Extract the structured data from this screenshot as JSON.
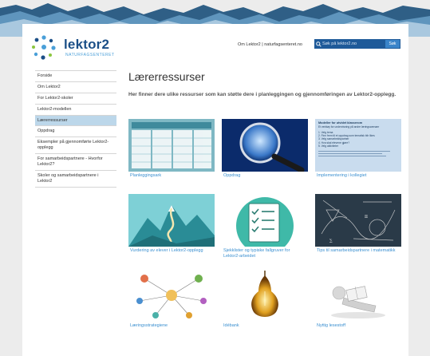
{
  "header": {
    "logo_name": "lektor2",
    "logo_subtitle": "NATURFAGSENTERET",
    "links": [
      "Om Lektor2",
      "|",
      "naturfagsenteret.no"
    ],
    "search_placeholder": "Søk på lektor2.no",
    "search_button": "Søk"
  },
  "sidebar": {
    "items": [
      {
        "label": "Forside"
      },
      {
        "label": "Om Lektor2"
      },
      {
        "label": "For Lektor2-skoler"
      },
      {
        "label": "Lektor2-modellen"
      },
      {
        "label": "Lærerressurser",
        "active": true
      },
      {
        "label": "Oppdrag"
      },
      {
        "label": "Eksempler på gjennomførte Lektor2-opplegg"
      },
      {
        "label": "For samarbeidspartnere - Hvorfor Lektor2?"
      },
      {
        "label": "Skoler og samarbeidspartnere i Lektor2"
      }
    ]
  },
  "main": {
    "title": "Lærerressurser",
    "intro": "Her finner dere ulike ressurser som kan støtte dere i planleggingen og gjennomføringen av Lektor2-opplegg.",
    "cards": [
      {
        "label": "Planleggingsark"
      },
      {
        "label": "Oppdrag"
      },
      {
        "label": "Implementering i kollegiet"
      },
      {
        "label": "Vurdering av elever i Lektor2-opplegg"
      },
      {
        "label": "Sjekklister og typiske fallgruver for Lektor2-arbeidet"
      },
      {
        "label": "Tips til samarbeidspartnere i matematikk"
      },
      {
        "label": "Læringsstrategiene"
      },
      {
        "label": "Idébank"
      },
      {
        "label": "Nyttig lesestoff"
      }
    ],
    "doc_thumb": {
      "heading": "Modeller for utvidet klasserom",
      "subheading": "Et verktøy for undervisning på andre læringsarenaer",
      "steps": [
        "1. Velg tema",
        "2. Finn frem til et oppdrag som tematisk blir likes",
        "3. Velg samarbeidspartner",
        "4. Hva skal elevene gjøre?",
        "5. Velg aktiviteter"
      ]
    }
  },
  "colors": {
    "brand_dark": "#1b4f87",
    "brand_light": "#4a9fd8",
    "active_nav": "#bcd7ea",
    "link": "#3a8fd0"
  }
}
